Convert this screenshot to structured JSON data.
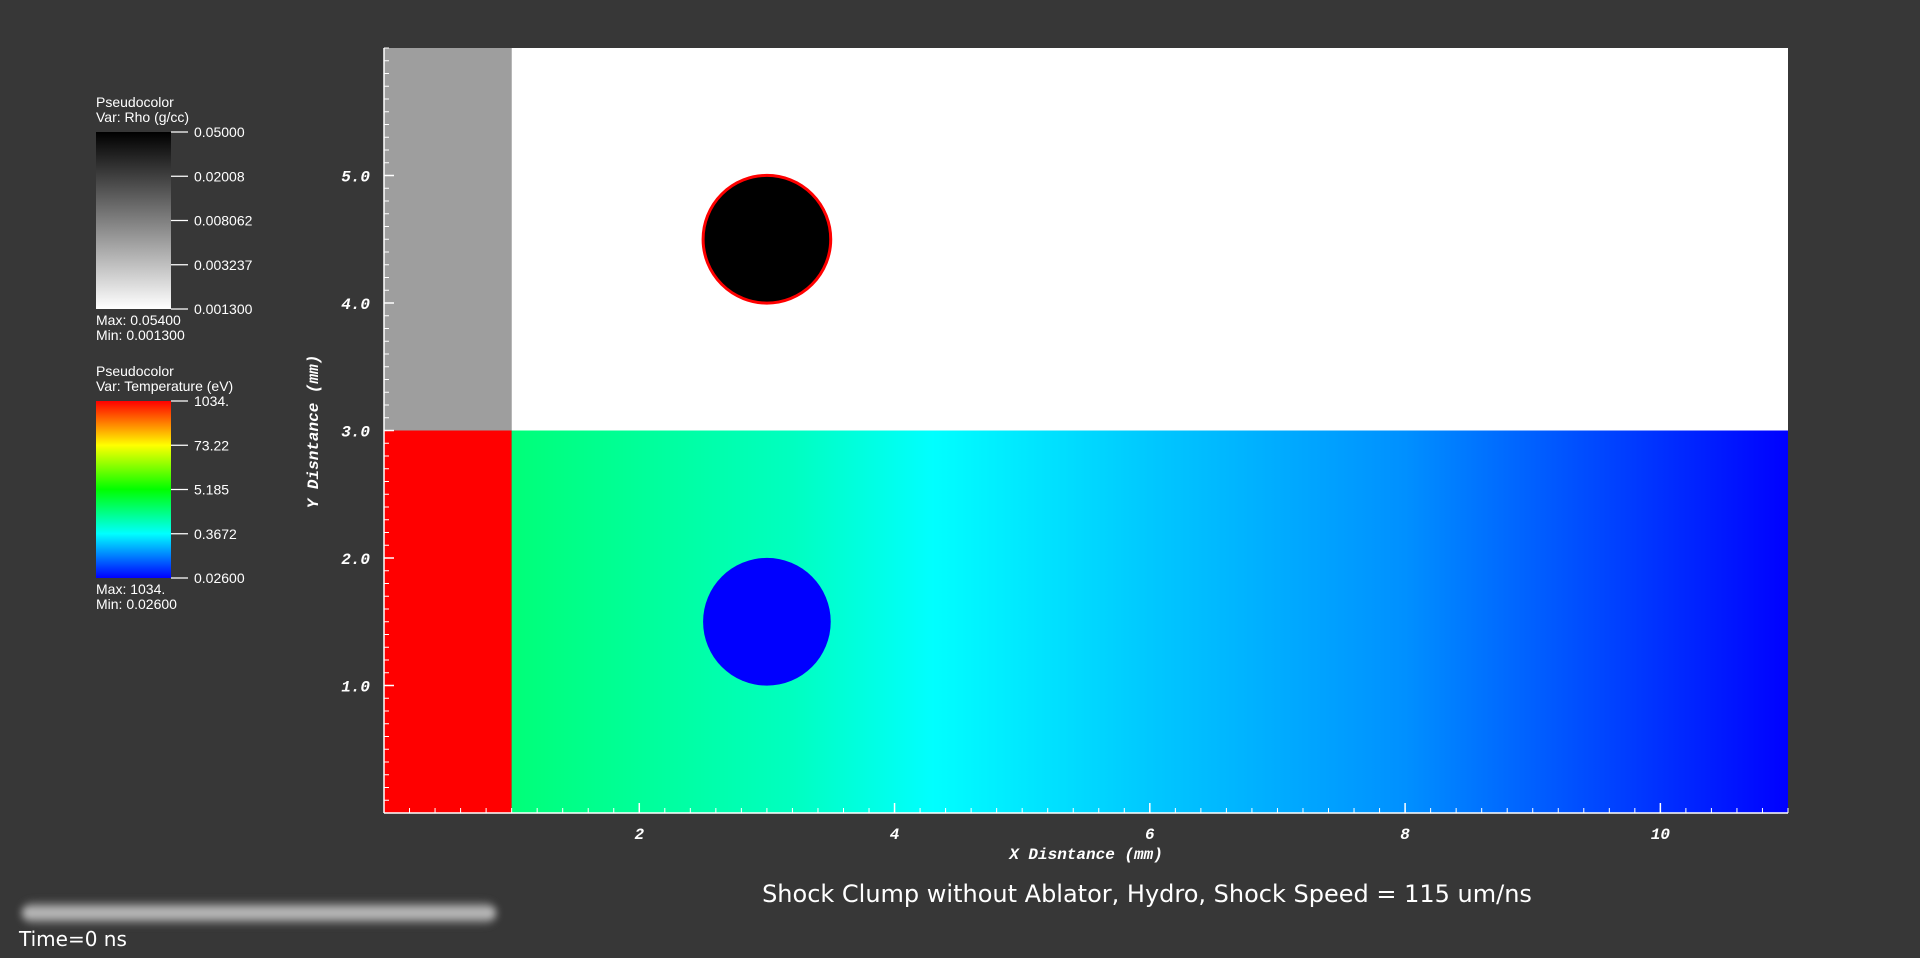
{
  "chart_data": {
    "type": "heatmap",
    "title": "Shock Clump without Ablator, Hydro, Shock Speed = 115 um/ns",
    "xlabel": "X Disntance (mm)",
    "ylabel": "Y Disntance (mm)",
    "xlim": [
      0,
      11
    ],
    "ylim": [
      0,
      6
    ],
    "x_ticks": [
      2,
      4,
      6,
      8,
      10
    ],
    "x_tick_labels": [
      "2",
      "4",
      "6",
      "8",
      "10"
    ],
    "y_ticks": [
      1.0,
      2.0,
      3.0,
      4.0,
      5.0
    ],
    "y_tick_labels": [
      "1.0",
      "2.0",
      "3.0",
      "4.0",
      "5.0"
    ],
    "time_label": "Time=0 ns",
    "legends": [
      {
        "type_label": "Pseudocolor",
        "var_label": "Var: Rho (g/cc)",
        "colormap": [
          "#000000",
          "#ffffff"
        ],
        "tick_labels": [
          "0.05000",
          "0.02008",
          "0.008062",
          "0.003237",
          "0.001300"
        ],
        "max_label": "Max:  0.05400",
        "min_label": "Min:  0.001300"
      },
      {
        "type_label": "Pseudocolor",
        "var_label": "Var: Temperature (eV)",
        "colormap": [
          "#ff0000",
          "#ffff00",
          "#00ff00",
          "#00ffff",
          "#0000ff"
        ],
        "tick_labels": [
          "1034.",
          "73.22",
          "5.185",
          "0.3672",
          "0.02600"
        ],
        "max_label": "Max:  1034.",
        "min_label": "Min:  0.02600"
      }
    ],
    "panels": [
      {
        "name": "density",
        "y_range": [
          3,
          6
        ],
        "regions": [
          {
            "shape": "rect",
            "x_range": [
              0,
              1
            ],
            "color": "#9e9e9e"
          },
          {
            "shape": "rect",
            "x_range": [
              1,
              11
            ],
            "color": "#ffffff"
          },
          {
            "shape": "circle",
            "cx": 3,
            "cy": 4.5,
            "r": 0.5,
            "fill": "#000000",
            "stroke": "#ff0000"
          }
        ]
      },
      {
        "name": "temperature",
        "y_range": [
          0,
          3
        ],
        "regions": [
          {
            "shape": "rect",
            "x_range": [
              0,
              1
            ],
            "color": "#ff0000"
          },
          {
            "shape": "gradient",
            "x_range": [
              1,
              11
            ],
            "stops": [
              {
                "x": 1,
                "color": "#00ff78"
              },
              {
                "x": 3.2,
                "color": "#00ffc0"
              },
              {
                "x": 4.3,
                "color": "#00ffff"
              },
              {
                "x": 6,
                "color": "#00c8ff"
              },
              {
                "x": 8,
                "color": "#0090ff"
              },
              {
                "x": 10,
                "color": "#0030ff"
              },
              {
                "x": 11,
                "color": "#0000ff"
              }
            ]
          },
          {
            "shape": "circle",
            "cx": 3,
            "cy": 1.5,
            "r": 0.5,
            "fill": "#0000ff"
          }
        ]
      }
    ]
  }
}
